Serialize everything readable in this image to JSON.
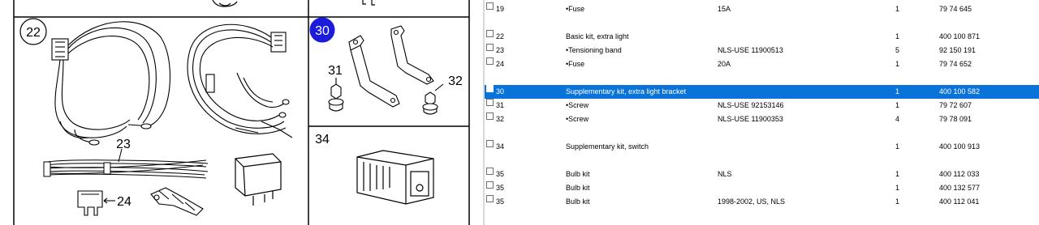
{
  "diagram": {
    "callouts": {
      "c22": "22",
      "c23": "23",
      "c24": "24",
      "c30": "30",
      "c31": "31",
      "c32": "32",
      "c34": "34"
    }
  },
  "parts": {
    "rows": [
      {
        "no": "19",
        "description": "•Fuse",
        "note": "15A",
        "qty": "1",
        "part_number": "79 74 645",
        "selected": false
      },
      {
        "no": "22",
        "description": "Basic kit, extra light",
        "note": "",
        "qty": "1",
        "part_number": "400 100 871",
        "selected": false
      },
      {
        "no": "23",
        "description": "•Tensioning band",
        "note": "NLS-USE 11900513",
        "qty": "5",
        "part_number": "92 150 191",
        "selected": false
      },
      {
        "no": "24",
        "description": "•Fuse",
        "note": "20A",
        "qty": "1",
        "part_number": "79 74 652",
        "selected": false
      },
      {
        "no": "30",
        "description": "Supplementary kit, extra light bracket",
        "note": "",
        "qty": "1",
        "part_number": "400 100 582",
        "selected": true
      },
      {
        "no": "31",
        "description": "•Screw",
        "note": "NLS-USE 92153146",
        "qty": "1",
        "part_number": "79 72 607",
        "selected": false
      },
      {
        "no": "32",
        "description": "•Screw",
        "note": "NLS-USE 11900353",
        "qty": "4",
        "part_number": "79 78 091",
        "selected": false
      },
      {
        "no": "34",
        "description": "Supplementary kit, switch",
        "note": "",
        "qty": "1",
        "part_number": "400 100 913",
        "selected": false
      },
      {
        "no": "35",
        "description": "Bulb kit",
        "note": "NLS",
        "qty": "1",
        "part_number": "400 112 033",
        "selected": false
      },
      {
        "no": "35",
        "description": "Bulb kit",
        "note": "",
        "qty": "1",
        "part_number": "400 132 577",
        "selected": false
      },
      {
        "no": "35",
        "description": "Bulb kit",
        "note": "1998-2002, US, NLS",
        "qty": "1",
        "part_number": "400 112 041",
        "selected": false
      }
    ]
  },
  "colors": {
    "selection": "#0a73d9",
    "callout_selected": "#1b1bd9"
  }
}
